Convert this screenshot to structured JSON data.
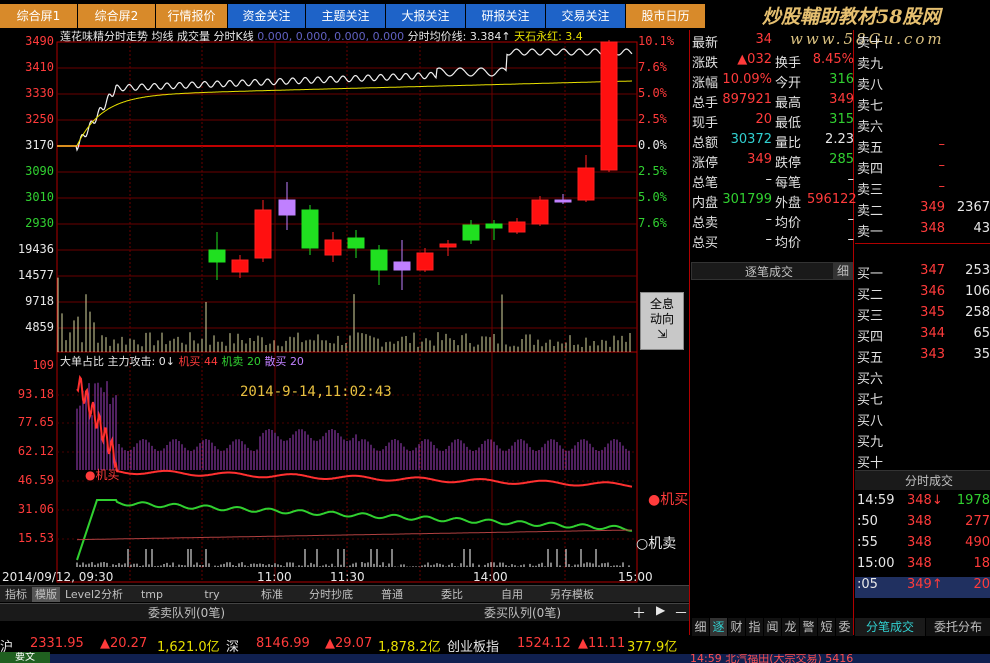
{
  "tabs": [
    {
      "label": "综合屏1",
      "style": "orange"
    },
    {
      "label": "综合屏2",
      "style": "orange"
    },
    {
      "label": "行情报价",
      "style": "orange"
    },
    {
      "label": "资金关注",
      "style": "blue"
    },
    {
      "label": "主题关注",
      "style": "blue"
    },
    {
      "label": "大报关注",
      "style": "blue"
    },
    {
      "label": "研报关注",
      "style": "blue"
    },
    {
      "label": "交易关注",
      "style": "blue"
    },
    {
      "label": "股市日历",
      "style": "orange"
    }
  ],
  "watermark": {
    "title": "炒股輔助教材58股网",
    "url": "www.58Gu.com"
  },
  "chart_header": {
    "left": "莲花味精分时走势",
    "items": "均线 成交量 分时K线",
    "zeros": "0.000, 0.000, 0.000, 0.000",
    "avg": "分时均价线: 3.384↑",
    "extra": "天石永红: 3.4"
  },
  "price_axis": [
    "3490",
    "3410",
    "3330",
    "3250",
    "3170",
    "3090",
    "3010",
    "2930"
  ],
  "vol_axis": [
    "19436",
    "14577",
    "9718",
    "4859"
  ],
  "pct_axis_up": [
    "10.1%",
    "7.6%",
    "5.0%",
    "2.5%",
    "0.0%"
  ],
  "pct_axis_down": [
    "2.5%",
    "5.0%",
    "7.6%"
  ],
  "lower_header": {
    "label": "大单占比",
    "attack": "主力攻击:",
    "attack_val": "0↓",
    "buy": "机买",
    "buy_val": "44",
    "sell": "机卖",
    "sell_val": "20",
    "retail": "散买",
    "retail_val": "20"
  },
  "lower_axis": [
    "109",
    "93.18",
    "77.65",
    "62.12",
    "46.59",
    "31.06",
    "15.53"
  ],
  "timestamp": "2014-9-14,11:02:43",
  "legend_buy": "机买",
  "legend_sell": "机卖",
  "time_axis": {
    "start": "2014/09/12, 09:30",
    "t1": "11:00",
    "t2": "11:30",
    "t3": "14:00",
    "t4": "15:00"
  },
  "info_button": {
    "line1": "全息",
    "line2": "动向"
  },
  "bottom_tabs": [
    "指标",
    "模版",
    "Level2分析",
    "tmp",
    "try",
    "标准",
    "分时抄底",
    "普通",
    "委比",
    "自用",
    "另存模板"
  ],
  "queue": {
    "sell": "委卖队列(0笔)",
    "buy": "委买队列(0笔)"
  },
  "quote": {
    "latest_label": "最新",
    "latest": "34",
    "change_label": "涨跌",
    "change": "▲032",
    "turn_label": "换手",
    "turn": "8.45%",
    "range_label": "涨幅",
    "range": "10.09%",
    "open_label": "今开",
    "open": "316",
    "vol_label": "总手",
    "vol": "897921",
    "high_label": "最高",
    "high": "349",
    "now_label": "现手",
    "now": "20",
    "low_label": "最低",
    "low": "315",
    "amt_label": "总额",
    "amt": "30372",
    "ratio_label": "量比",
    "ratio": "2.23",
    "limup_label": "涨停",
    "limup": "349",
    "limdown_label": "跌停",
    "limdown": "285",
    "trades_label": "总笔",
    "trades": "–",
    "pertrade_label": "每笔",
    "pertrade": "–",
    "inner_label": "内盘",
    "inner": "301799",
    "outer_label": "外盘",
    "outer": "596122",
    "sellavg_label": "总卖",
    "sellavg": "–",
    "sellavg2_label": "均价",
    "sellavg2": "–",
    "buyavg_label": "总买",
    "buyavg": "–",
    "buyavg2_label": "均价",
    "buyavg2": "–",
    "ticks_label": "逐笔成交",
    "ticks_btn": "细"
  },
  "orderbook": {
    "sells": [
      {
        "label": "卖十",
        "price": "",
        "vol": ""
      },
      {
        "label": "卖九",
        "price": "",
        "vol": ""
      },
      {
        "label": "卖八",
        "price": "",
        "vol": ""
      },
      {
        "label": "卖七",
        "price": "",
        "vol": ""
      },
      {
        "label": "卖六",
        "price": "",
        "vol": ""
      },
      {
        "label": "卖五",
        "price": "–",
        "vol": ""
      },
      {
        "label": "卖四",
        "price": "–",
        "vol": ""
      },
      {
        "label": "卖三",
        "price": "–",
        "vol": ""
      },
      {
        "label": "卖二",
        "price": "349",
        "vol": "2367"
      },
      {
        "label": "卖一",
        "price": "348",
        "vol": "43"
      }
    ],
    "buys": [
      {
        "label": "买一",
        "price": "347",
        "vol": "253"
      },
      {
        "label": "买二",
        "price": "346",
        "vol": "106"
      },
      {
        "label": "买三",
        "price": "345",
        "vol": "258"
      },
      {
        "label": "买四",
        "price": "344",
        "vol": "65"
      },
      {
        "label": "买五",
        "price": "343",
        "vol": "35"
      },
      {
        "label": "买六",
        "price": "",
        "vol": ""
      },
      {
        "label": "买七",
        "price": "",
        "vol": ""
      },
      {
        "label": "买八",
        "price": "",
        "vol": ""
      },
      {
        "label": "买九",
        "price": "",
        "vol": ""
      },
      {
        "label": "买十",
        "price": "",
        "vol": ""
      }
    ]
  },
  "ticks_title": "分时成交",
  "ticks": [
    {
      "time": "14:59",
      "price": "348↓",
      "vol": "1978"
    },
    {
      "time": ":50",
      "price": "348",
      "vol": "277"
    },
    {
      "time": ":55",
      "price": "348",
      "vol": "490"
    },
    {
      "time": "15:00",
      "price": "348",
      "vol": "18"
    },
    {
      "time": ":05",
      "price": "349↑",
      "vol": "20"
    }
  ],
  "right_tabs": [
    "细",
    "逐",
    "财",
    "指",
    "闻",
    "龙",
    "警",
    "短",
    "委"
  ],
  "right_tabs2": [
    "分笔成交",
    "委托分布"
  ],
  "ticker": [
    {
      "text": "沪",
      "cls": "white"
    },
    {
      "text": "2331.95",
      "cls": "red"
    },
    {
      "text": "▲20.27",
      "cls": "red"
    },
    {
      "text": "1,621.0亿",
      "cls": "yellow"
    },
    {
      "text": "深",
      "cls": "white"
    },
    {
      "text": "8146.99",
      "cls": "red"
    },
    {
      "text": "▲29.07",
      "cls": "red"
    },
    {
      "text": "1,878.2亿",
      "cls": "yellow"
    },
    {
      "text": "创业板指",
      "cls": "white"
    },
    {
      "text": "1524.12",
      "cls": "red"
    },
    {
      "text": "▲11.11",
      "cls": "red"
    },
    {
      "text": "377.9亿",
      "cls": "yellow"
    }
  ],
  "footer": {
    "left": "要文",
    "news": "14:59 北汽福田(大宗交易) 5416"
  }
}
